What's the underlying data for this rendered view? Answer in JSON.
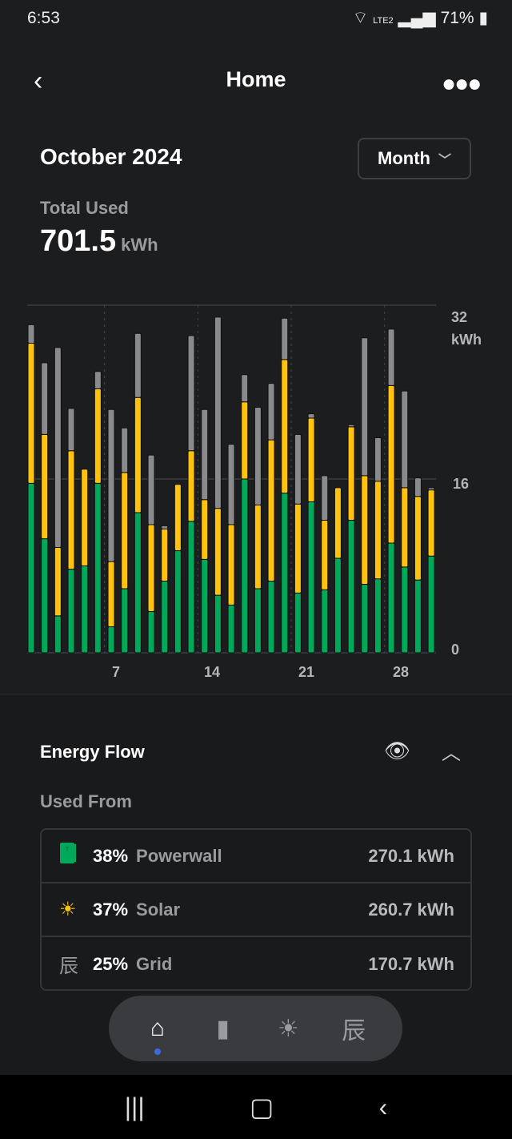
{
  "status_bar": {
    "time": "6:53",
    "battery": "71%",
    "network": "LTE2"
  },
  "header": {
    "title": "Home",
    "back_icon": "chevron-left-icon",
    "more_icon": "more-horizontal-icon"
  },
  "period": {
    "title": "October 2024",
    "selector": "Month"
  },
  "total": {
    "label": "Total Used",
    "value": "701.5",
    "unit": "kWh"
  },
  "colors": {
    "powerwall": "#00a85a",
    "solar": "#ffc20e",
    "grid": "#8a8a8c",
    "background": "#1c1d1f"
  },
  "chart_data": {
    "type": "bar",
    "stacked": true,
    "x": [
      1,
      2,
      3,
      4,
      5,
      6,
      7,
      8,
      9,
      10,
      11,
      12,
      13,
      14,
      15,
      16,
      17,
      18,
      19,
      20,
      21,
      22,
      23,
      24,
      25,
      26,
      27,
      28,
      29,
      30,
      31
    ],
    "x_tick_labels": [
      "7",
      "14",
      "21",
      "28"
    ],
    "y_tick_labels": [
      "0",
      "16",
      "32"
    ],
    "ylabel": "kWh",
    "ylim": [
      0,
      32
    ],
    "grid": true,
    "series": [
      {
        "values": [
          15.6,
          10.5,
          3.4,
          7.7,
          8.0,
          15.6,
          2.4,
          5.9,
          12.9,
          3.8,
          6.6,
          9.4,
          12.1,
          8.6,
          5.3,
          4.4,
          16.0,
          5.9,
          6.6,
          14.7,
          5.5,
          13.9,
          5.8,
          8.7,
          12.2,
          6.3,
          6.8,
          10.1,
          7.9,
          6.7,
          8.9
        ],
        "color": "#00a85a"
      },
      {
        "values": [
          12.9,
          9.6,
          6.3,
          10.9,
          8.9,
          8.7,
          6.0,
          10.7,
          10.6,
          8.0,
          4.8,
          6.1,
          6.5,
          5.5,
          8.0,
          7.4,
          7.1,
          7.7,
          13.0,
          12.3,
          8.2,
          7.7,
          6.4,
          6.5,
          8.6,
          10.0,
          9.0,
          14.5,
          7.3,
          7.7,
          6.1
        ],
        "color": "#ffc20e"
      },
      {
        "values": [
          1.7,
          6.6,
          18.4,
          3.9,
          0,
          1.6,
          14.0,
          4.1,
          5.9,
          6.4,
          0.3,
          0,
          10.6,
          8.3,
          17.6,
          7.4,
          2.5,
          9.0,
          5.2,
          3.8,
          6.4,
          0.4,
          4.1,
          0,
          0.2,
          12.7,
          4.0,
          5.2,
          8.9,
          1.7,
          0.2
        ],
        "color": "#8a8a8c"
      }
    ]
  },
  "energy_flow": {
    "title": "Energy Flow",
    "subtitle": "Used From",
    "sources": [
      {
        "icon": "powerwall-icon",
        "percent": "38%",
        "name": "Powerwall",
        "value": "270.1 kWh"
      },
      {
        "icon": "solar-icon",
        "percent": "37%",
        "name": "Solar",
        "value": "260.7 kWh"
      },
      {
        "icon": "grid-tower-icon",
        "percent": "25%",
        "name": "Grid",
        "value": "170.7 kWh"
      }
    ]
  },
  "tabs": [
    {
      "icon": "home-icon",
      "active": true
    },
    {
      "icon": "powerwall-icon"
    },
    {
      "icon": "solar-icon"
    },
    {
      "icon": "grid-tower-icon"
    }
  ]
}
